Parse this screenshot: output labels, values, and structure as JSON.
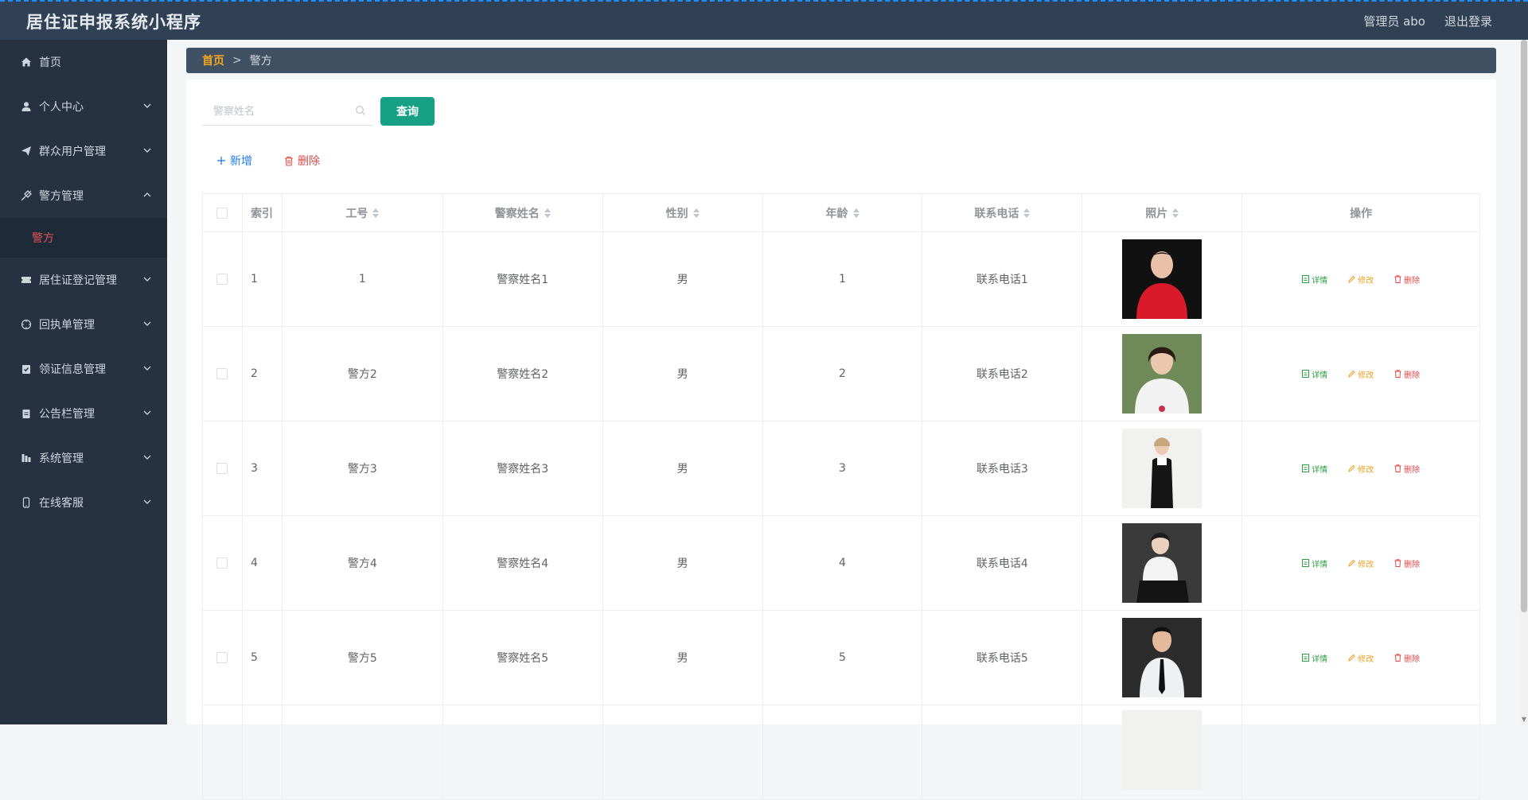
{
  "app": {
    "title": "居住证申报系统小程序"
  },
  "header": {
    "user_label": "管理员 abo",
    "logout_label": "退出登录"
  },
  "sidebar": {
    "items": [
      {
        "label": "首页",
        "icon": "home-icon",
        "has_children": false
      },
      {
        "label": "个人中心",
        "icon": "user-icon",
        "has_children": true
      },
      {
        "label": "群众用户管理",
        "icon": "send-icon",
        "has_children": true
      },
      {
        "label": "警方管理",
        "icon": "badge-icon",
        "has_children": true,
        "expanded": true
      },
      {
        "label": "居住证登记管理",
        "icon": "ticket-icon",
        "has_children": true
      },
      {
        "label": "回执单管理",
        "icon": "target-icon",
        "has_children": true
      },
      {
        "label": "领证信息管理",
        "icon": "clipboard-check-icon",
        "has_children": true
      },
      {
        "label": "公告栏管理",
        "icon": "clipboard-icon",
        "has_children": true
      },
      {
        "label": "系统管理",
        "icon": "chart-icon",
        "has_children": true
      },
      {
        "label": "在线客服",
        "icon": "phone-icon",
        "has_children": true
      }
    ],
    "sub_active": "警方"
  },
  "breadcrumb": {
    "home": "首页",
    "separator": ">",
    "current": "警方"
  },
  "search": {
    "placeholder": "警察姓名",
    "query_label": "查询"
  },
  "actions": {
    "add_label": "新增",
    "delete_label": "删除"
  },
  "table": {
    "columns": [
      "索引",
      "工号",
      "警察姓名",
      "性别",
      "年龄",
      "联系电话",
      "照片",
      "操作"
    ],
    "sortable": [
      false,
      true,
      true,
      true,
      true,
      true,
      true,
      false
    ],
    "rows": [
      {
        "index": "1",
        "job_no": "1",
        "name": "警察姓名1",
        "gender": "男",
        "age": "1",
        "phone": "联系电话1",
        "photo": "red-blouse-woman"
      },
      {
        "index": "2",
        "job_no": "警方2",
        "name": "警察姓名2",
        "gender": "男",
        "age": "2",
        "phone": "联系电话2",
        "photo": "white-blouse-woman"
      },
      {
        "index": "3",
        "job_no": "警方3",
        "name": "警察姓名3",
        "gender": "男",
        "age": "3",
        "phone": "联系电话3",
        "photo": "black-suit-woman"
      },
      {
        "index": "4",
        "job_no": "警方4",
        "name": "警察姓名4",
        "gender": "男",
        "age": "4",
        "phone": "联系电话4",
        "photo": "seated-woman"
      },
      {
        "index": "5",
        "job_no": "警方5",
        "name": "警察姓名5",
        "gender": "男",
        "age": "5",
        "phone": "联系电话5",
        "photo": "man-with-tie"
      }
    ],
    "row_actions": {
      "detail": "详情",
      "edit": "修改",
      "delete": "删除"
    }
  },
  "colors": {
    "topbar": "#304156",
    "sidebar": "#263242",
    "accent_teal": "#16a085",
    "breadcrumb_home": "#f5a623",
    "active_sub": "#e25555"
  }
}
